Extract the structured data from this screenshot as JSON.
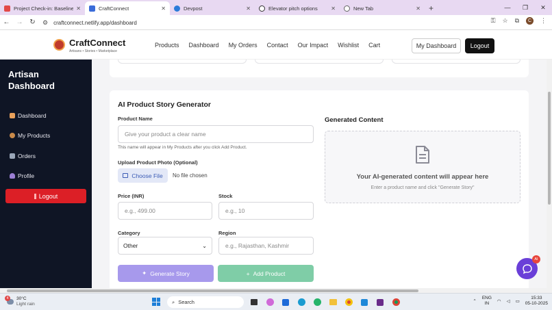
{
  "browser": {
    "tabs": [
      {
        "title": "Project Check-in: Baseline Tools",
        "color": "#e24848",
        "active": false
      },
      {
        "title": "CraftConnect",
        "color": "#3a6cd9",
        "active": true
      },
      {
        "title": "Devpost",
        "color": "#2b7bd9",
        "active": false
      },
      {
        "title": "Elevator pitch options",
        "color": "#333333",
        "active": false
      },
      {
        "title": "New Tab",
        "color": "#666666",
        "active": false
      }
    ],
    "new_tab_symbol": "+",
    "url": "craftconnect.netlify.app/dashboard",
    "profile_initial": "C"
  },
  "header": {
    "brand": "CraftConnect",
    "tagline": "Artisans • Stories • Marketplace",
    "nav": [
      "Products",
      "Dashboard",
      "My Orders",
      "Contact",
      "Our Impact",
      "Wishlist",
      "Cart"
    ],
    "my_dashboard": "My Dashboard",
    "logout": "Logout"
  },
  "sidebar": {
    "title_line1": "Artisan",
    "title_line2": "Dashboard",
    "items": [
      {
        "label": "Dashboard",
        "icon_color": "#e9a15b"
      },
      {
        "label": "My Products",
        "icon_color": "#c98a4a"
      },
      {
        "label": "Orders",
        "icon_color": "#9aa6b8"
      },
      {
        "label": "Profile",
        "icon_color": "#9b7fd4"
      }
    ],
    "logout": "Logout"
  },
  "generator": {
    "title": "AI Product Story Generator",
    "product_name_label": "Product Name",
    "product_name_placeholder": "Give your product a clear name",
    "product_name_hint": "This name will appear in My Products after you click Add Product.",
    "photo_label": "Upload Product Photo (Optional)",
    "choose_file": "Choose File",
    "no_file": "No file chosen",
    "price_label": "Price (INR)",
    "price_placeholder": "e.g., 499.00",
    "stock_label": "Stock",
    "stock_placeholder": "e.g., 10",
    "category_label": "Category",
    "category_value": "Other",
    "region_label": "Region",
    "region_placeholder": "e.g., Rajasthan, Kashmir",
    "generate_button": "Generate Story",
    "add_button": "Add Product",
    "output_title": "Generated Content",
    "output_main": "Your AI-generated content will appear here",
    "output_sub": "Enter a product name and click \"Generate Story\""
  },
  "chat": {
    "badge": "AI"
  },
  "taskbar": {
    "temperature": "30°C",
    "weather": "Light rain",
    "weather_badge": "4",
    "search": "Search",
    "lang1": "ENG",
    "lang2": "IN",
    "time": "15:33",
    "date": "05-10-2025"
  },
  "colors": {
    "accent": "#6a3fd8",
    "sidebar_bg": "#0f1525",
    "logout_red": "#dc1f26"
  }
}
